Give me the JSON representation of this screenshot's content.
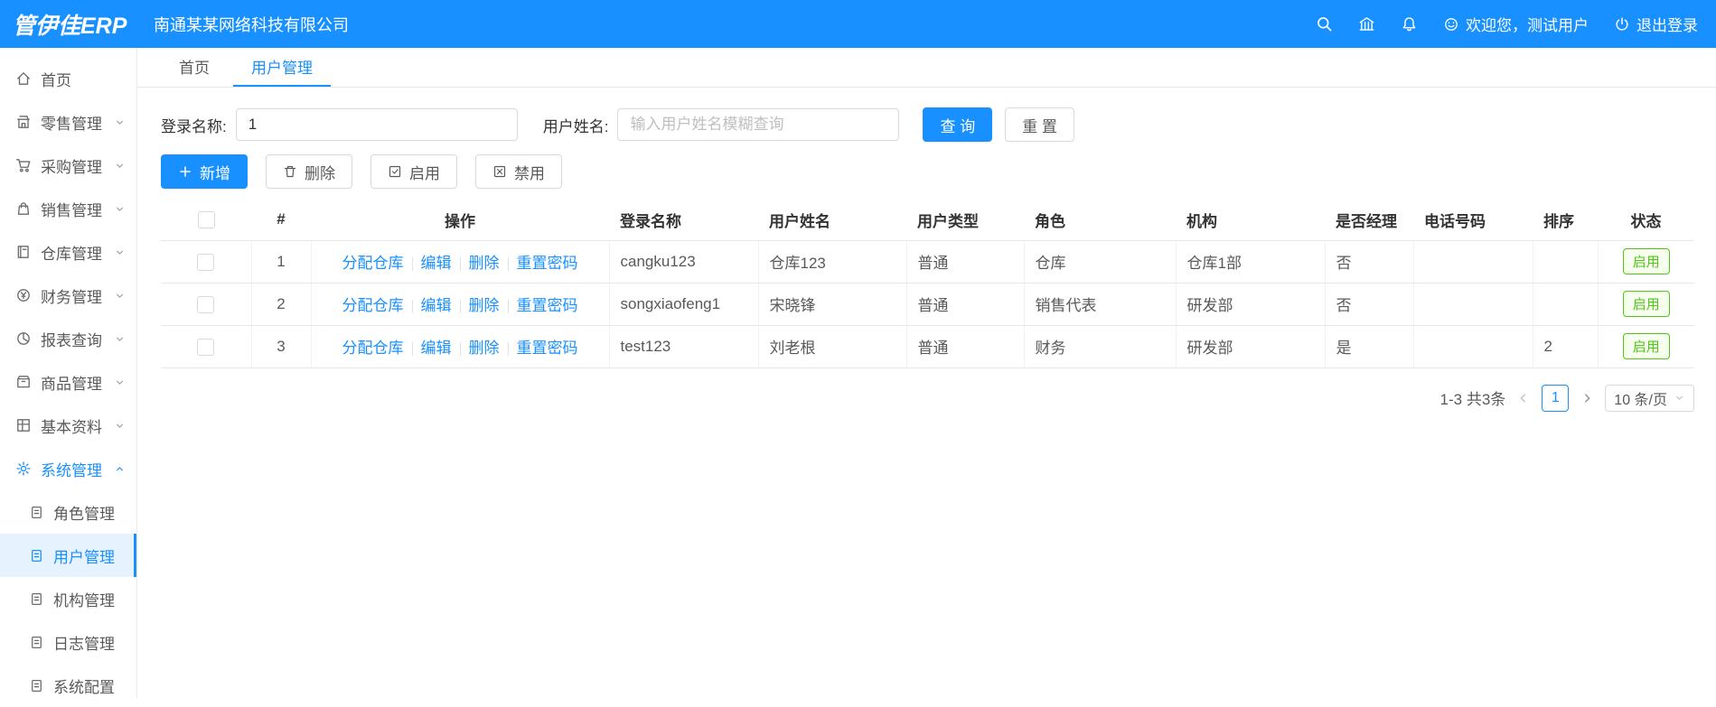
{
  "header": {
    "logo": "管伊佳ERP",
    "company": "南通某某网络科技有限公司",
    "welcome": "欢迎您，测试用户",
    "logout": "退出登录"
  },
  "sidebar": {
    "items": [
      {
        "label": "首页"
      },
      {
        "label": "零售管理"
      },
      {
        "label": "采购管理"
      },
      {
        "label": "销售管理"
      },
      {
        "label": "仓库管理"
      },
      {
        "label": "财务管理"
      },
      {
        "label": "报表查询"
      },
      {
        "label": "商品管理"
      },
      {
        "label": "基本资料"
      },
      {
        "label": "系统管理"
      }
    ],
    "subitems": [
      {
        "label": "角色管理"
      },
      {
        "label": "用户管理"
      },
      {
        "label": "机构管理"
      },
      {
        "label": "日志管理"
      },
      {
        "label": "系统配置"
      }
    ]
  },
  "tabs": [
    {
      "label": "首页"
    },
    {
      "label": "用户管理"
    }
  ],
  "search": {
    "login_label": "登录名称:",
    "login_value": "1",
    "name_label": "用户姓名:",
    "name_placeholder": "输入用户姓名模糊查询",
    "query_label": "查 询",
    "reset_label": "重 置"
  },
  "toolbar": {
    "add_label": "新增",
    "delete_label": "删除",
    "enable_label": "启用",
    "disable_label": "禁用"
  },
  "table": {
    "headers": [
      "#",
      "操作",
      "登录名称",
      "用户姓名",
      "用户类型",
      "角色",
      "机构",
      "是否经理",
      "电话号码",
      "排序",
      "状态"
    ],
    "action_links": [
      "分配仓库",
      "编辑",
      "删除",
      "重置密码"
    ],
    "rows": [
      {
        "index": "1",
        "login": "cangku123",
        "name": "仓库123",
        "type": "普通",
        "role": "仓库",
        "org": "仓库1部",
        "manager": "否",
        "phone": "",
        "sort": "",
        "status": "启用"
      },
      {
        "index": "2",
        "login": "songxiaofeng1",
        "name": "宋晓锋",
        "type": "普通",
        "role": "销售代表",
        "org": "研发部",
        "manager": "否",
        "phone": "",
        "sort": "",
        "status": "启用"
      },
      {
        "index": "3",
        "login": "test123",
        "name": "刘老根",
        "type": "普通",
        "role": "财务",
        "org": "研发部",
        "manager": "是",
        "phone": "",
        "sort": "2",
        "status": "启用"
      }
    ]
  },
  "pagination": {
    "range_text": "1-3 共3条",
    "current_page": "1",
    "page_size": "10 条/页"
  },
  "colors": {
    "primary": "#1890ff",
    "success": "#52c41a"
  }
}
